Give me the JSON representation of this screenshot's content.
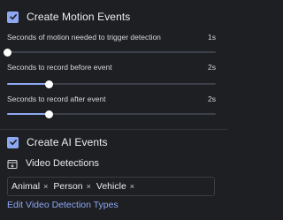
{
  "motion": {
    "checkbox_label": "Create Motion Events",
    "checked": true,
    "settings": [
      {
        "label": "Seconds of motion needed to trigger detection",
        "value_text": "1s",
        "level": 0.0
      },
      {
        "label": "Seconds to record before event",
        "value_text": "2s",
        "level": 0.2
      },
      {
        "label": "Seconds to record after event",
        "value_text": "2s",
        "level": 0.2
      }
    ]
  },
  "ai": {
    "checkbox_label": "Create AI Events",
    "checked": true,
    "video_detections_label": "Video Detections",
    "chips": [
      {
        "label": "Animal",
        "remove": "×"
      },
      {
        "label": "Person",
        "remove": "×"
      },
      {
        "label": "Vehicle",
        "remove": "×"
      }
    ],
    "edit_link": "Edit Video Detection Types"
  },
  "colors": {
    "accent": "#8ea7f2",
    "background": "#1d1f23"
  },
  "icons": {
    "checkbox": "check-icon",
    "section": "video-detections-icon"
  }
}
